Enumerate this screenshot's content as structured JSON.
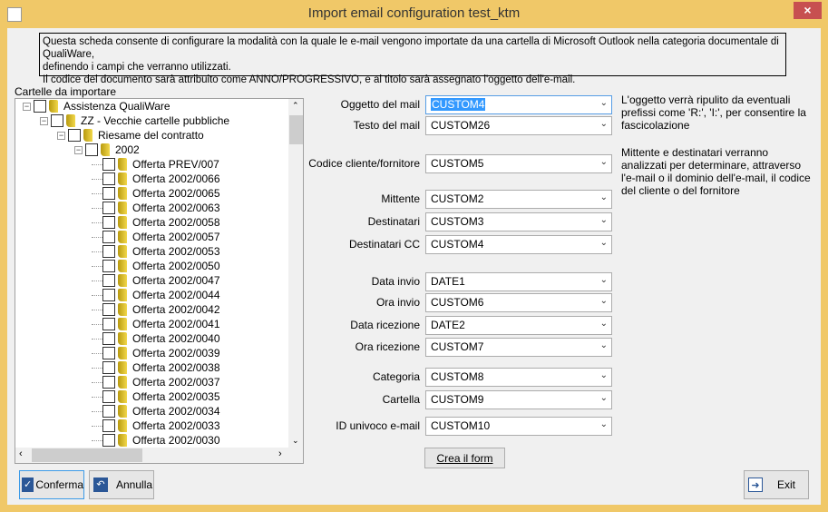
{
  "window": {
    "title": "Import email configuration test_ktm",
    "close_label": "×"
  },
  "info": {
    "lines": [
      "Questa scheda consente di configurare la modalità con la quale le e-mail vengono importate da una cartella di Microsoft Outlook nella categoria documentale di QualiWare,",
      "definendo i campi che verranno utilizzati.",
      "Il codice del documento sarà attribuito come ANNO/PROGRESSIVO, e al titolo sarà assegnato l'oggetto dell'e-mail."
    ]
  },
  "tree": {
    "label": "Cartelle da importare",
    "nodes": [
      {
        "label": "Assistenza QualiWare",
        "level": 0
      },
      {
        "label": "ZZ - Vecchie cartelle pubbliche",
        "level": 1
      },
      {
        "label": "Riesame del contratto",
        "level": 2
      },
      {
        "label": "2002",
        "level": 3
      }
    ],
    "leaves": [
      "Offerta PREV/007",
      "Offerta 2002/0066",
      "Offerta 2002/0065",
      "Offerta 2002/0063",
      "Offerta 2002/0058",
      "Offerta 2002/0057",
      "Offerta 2002/0053",
      "Offerta 2002/0050",
      "Offerta 2002/0047",
      "Offerta 2002/0044",
      "Offerta 2002/0042",
      "Offerta 2002/0041",
      "Offerta 2002/0040",
      "Offerta 2002/0039",
      "Offerta 2002/0038",
      "Offerta 2002/0037",
      "Offerta 2002/0035",
      "Offerta 2002/0034",
      "Offerta 2002/0033",
      "Offerta 2002/0030"
    ]
  },
  "fields": [
    {
      "label": "Oggetto del mail",
      "value": "CUSTOM4"
    },
    {
      "label": "Testo del mail",
      "value": "CUSTOM26"
    },
    {
      "label": "Codice cliente/fornitore",
      "value": "CUSTOM5"
    },
    {
      "label": "Mittente",
      "value": "CUSTOM2"
    },
    {
      "label": "Destinatari",
      "value": "CUSTOM3"
    },
    {
      "label": "Destinatari CC",
      "value": "CUSTOM4"
    },
    {
      "label": "Data invio",
      "value": "DATE1"
    },
    {
      "label": "Ora invio",
      "value": "CUSTOM6"
    },
    {
      "label": "Data ricezione",
      "value": "DATE2"
    },
    {
      "label": "Ora ricezione",
      "value": "CUSTOM7"
    },
    {
      "label": "Categoria",
      "value": "CUSTOM8"
    },
    {
      "label": "Cartella",
      "value": "CUSTOM9"
    },
    {
      "label": "ID univoco e-mail",
      "value": "CUSTOM10"
    }
  ],
  "notes": [
    "L'oggetto verrà ripulito da eventuali prefissi come 'R:', 'I:', per consentire la fascicolazione",
    "Mittente e destinatari verranno analizzati per determinare, attraverso l'e-mail o il dominio dell'e-mail, il codice del cliente o del fornitore"
  ],
  "buttons": {
    "create_form": "Crea il form",
    "confirm": "Conferma",
    "cancel": "Annulla",
    "exit": "Exit"
  }
}
